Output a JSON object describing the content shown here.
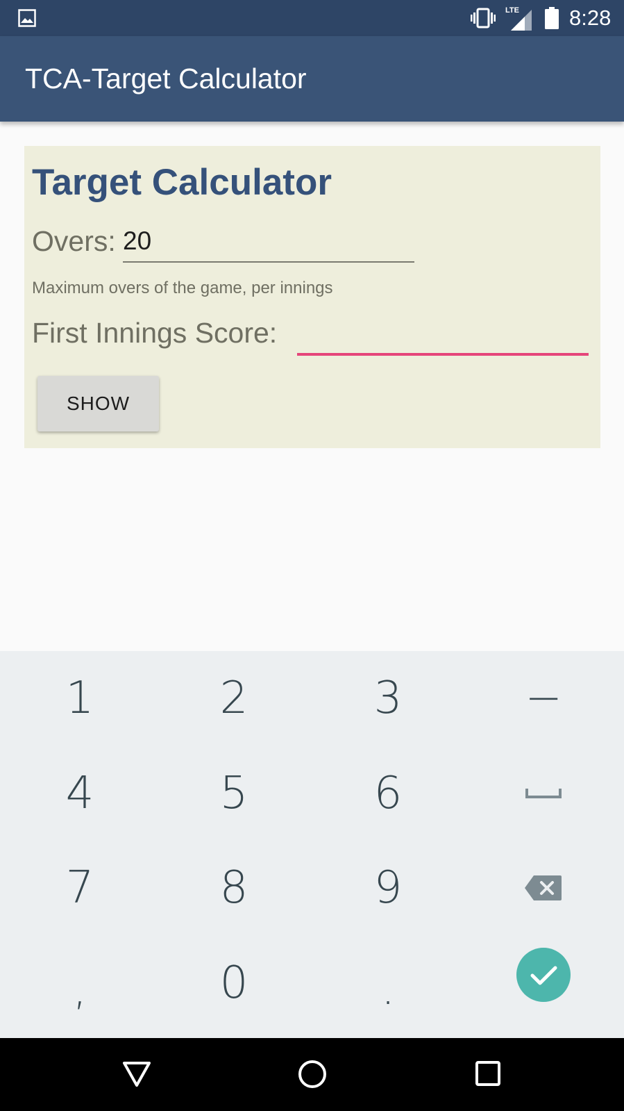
{
  "status_bar": {
    "icons": [
      "gallery-icon",
      "vibrate-icon",
      "lte-signal-icon",
      "battery-icon"
    ],
    "network_label": "LTE",
    "time": "8:28"
  },
  "app_bar": {
    "title": "TCA-Target Calculator",
    "color": "#3a5477"
  },
  "form": {
    "heading": "Target Calculator",
    "overs_label": "Overs:",
    "overs_value": "20",
    "overs_hint": "Maximum overs of the game, per innings",
    "score_label": "First Innings Score:",
    "score_value": "",
    "show_button": "SHOW",
    "accent_color": "#e5457a",
    "card_color": "#eeeedc"
  },
  "keyboard": {
    "rows": [
      [
        "1",
        "2",
        "3",
        "−"
      ],
      [
        "4",
        "5",
        "6",
        "space-icon"
      ],
      [
        "7",
        "8",
        "9",
        "backspace-icon"
      ],
      [
        ",",
        "0",
        ".",
        "done-check-icon"
      ]
    ],
    "done_color": "#4db6ac"
  },
  "nav_bar": {
    "icons": [
      "back-triangle-icon",
      "home-circle-icon",
      "recents-square-icon"
    ]
  }
}
